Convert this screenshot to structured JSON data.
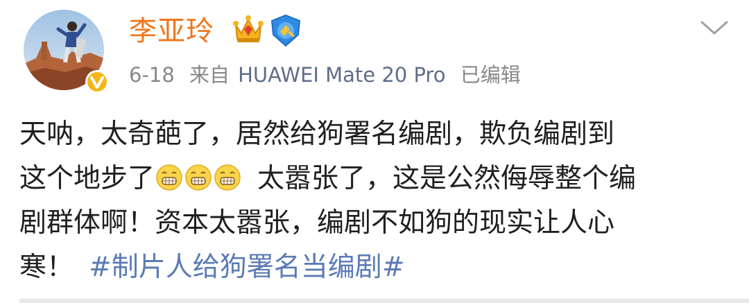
{
  "user": {
    "name": "李亚玲",
    "date": "6-18",
    "source_prefix": "来自",
    "device": "HUAWEI Mate 20 Pro",
    "edited": "已编辑"
  },
  "post": {
    "lines": [
      {
        "pre": "天呐，太奇葩了，居然给狗署名编剧，欺负编剧到"
      },
      {
        "pre": "这个地步了",
        "post": "太嚣张了，这是公然侮辱整个编"
      },
      {
        "pre": "剧群体啊！资本太嚣张，编剧不如狗的现实让人心"
      },
      {
        "pre": "寒！"
      }
    ],
    "hashtag": "#制片人给狗署名当编剧#"
  },
  "icons": {
    "crown": "crown-icon",
    "verified": "blue-v-badge-icon",
    "avatar_badge": "yellow-v-verified-icon",
    "more": "chevron-down-icon",
    "emoji": "grimace-emoji-icon"
  },
  "colors": {
    "username": "#f0761d",
    "meta": "#888888",
    "hashtag": "#5b7bb4",
    "text": "#1f1f1f"
  }
}
